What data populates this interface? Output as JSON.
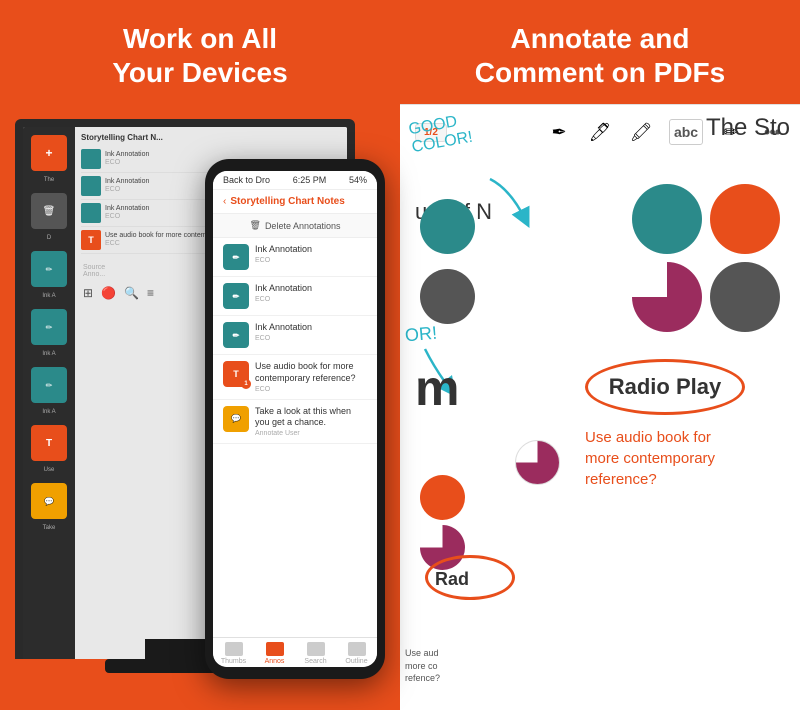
{
  "left_panel": {
    "heading_line1": "Work on All",
    "heading_line2": "Your Devices",
    "phone": {
      "status_bar": {
        "back_label": "Back to Dro",
        "time": "6:25 PM",
        "battery": "54%"
      },
      "nav_title": "Storytelling Chart Notes",
      "action_label": "Delete Annotations",
      "list_items": [
        {
          "icon": "ink",
          "title": "Ink Annotation",
          "sub": "ECO",
          "badge": ""
        },
        {
          "icon": "ink",
          "title": "Ink Annotation",
          "sub": "ECO",
          "badge": ""
        },
        {
          "icon": "ink",
          "title": "Ink Annotation",
          "sub": "ECO",
          "badge": ""
        },
        {
          "icon": "T",
          "title": "Use audio book for more contemporary reference?",
          "sub": "ECO",
          "badge": "1"
        },
        {
          "icon": "msg",
          "title": "Take a look at this when you get a chance.",
          "sub": "Annotate User",
          "badge": ""
        }
      ],
      "tabs": [
        {
          "label": "Thumbs",
          "active": false
        },
        {
          "label": "Annos",
          "active": true
        },
        {
          "label": "Search",
          "active": false
        },
        {
          "label": "Outline",
          "active": false
        }
      ]
    },
    "desktop": {
      "sidebar_items": [
        "D",
        "Ink A",
        "Ink A",
        "Ink A",
        "Use",
        "Take"
      ],
      "content_rows": [
        {
          "label": "Ink Annotation",
          "sub": "ECO"
        },
        {
          "label": "Ink Annotation",
          "sub": "ECO"
        },
        {
          "label": "Ink Annotation",
          "sub": "ECO"
        }
      ]
    }
  },
  "right_panel": {
    "heading_line1": "Annotate and",
    "heading_line2": "Comment on PDFs",
    "pdf": {
      "title": "The Sto",
      "annotation_text": "GOOD\nCOLOR!",
      "um_of_n_text": "um of N",
      "circles": [
        {
          "color": "teal",
          "label": "teal circle top-left"
        },
        {
          "color": "orange",
          "label": "orange circle top-right"
        },
        {
          "color": "teal",
          "label": "teal circle top-right"
        },
        {
          "color": "purple-pie",
          "label": "purple pie"
        },
        {
          "color": "dark",
          "label": "dark circle"
        }
      ],
      "radio_play_label": "Radio Play",
      "audio_book_text": "Use audio book for\nmore contemporary\nreference?",
      "bottom_use_text": "Use aud\nmore co\nrefence?",
      "rad_text": "Rad",
      "toolbar": {
        "page_num": "1/2",
        "tools": [
          "pen-light",
          "pen-dark",
          "highlighter",
          "abc",
          "pencil",
          "more"
        ]
      }
    }
  }
}
